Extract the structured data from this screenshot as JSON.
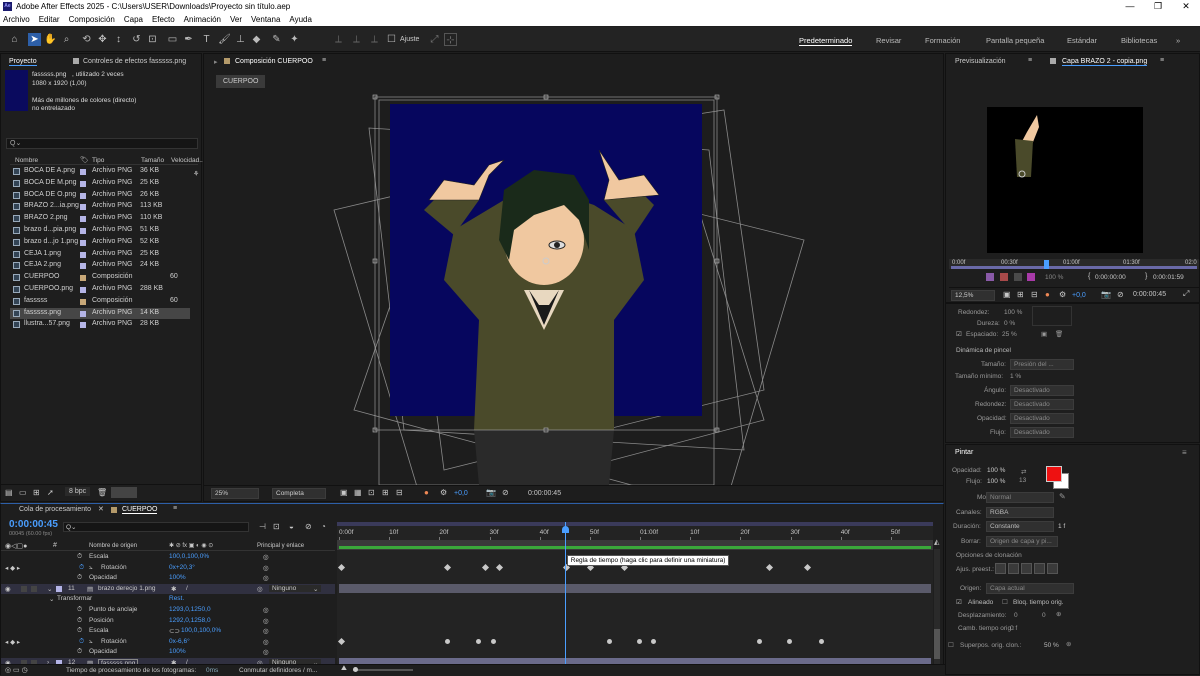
{
  "window": {
    "title": "Adobe After Effects 2025 - C:\\Users\\USER\\Downloads\\Proyecto sin título.aep",
    "app_icon": "Ae",
    "minimize": "—",
    "maximize": "❐",
    "close": "✕"
  },
  "menu": [
    "Archivo",
    "Editar",
    "Composición",
    "Capa",
    "Efecto",
    "Animación",
    "Ver",
    "Ventana",
    "Ayuda"
  ],
  "toolbar": {
    "snap_label": "Ajuste",
    "workspaces": [
      "Predeterminado",
      "Revisar",
      "Formación",
      "Pantalla pequeña",
      "Estándar",
      "Bibliotecas"
    ]
  },
  "project": {
    "tab": "Proyecto",
    "effects_tab": "Controles de efectos fasssss.png",
    "item_name": "fasssss.png",
    "item_usage": ", utilizado 2 veces",
    "item_dims": "1080 x 1920 (1,00)",
    "item_colors": "Más de millones de colores (directo)",
    "item_interlace": "no entrelazado",
    "search_placeholder": "Q⌄",
    "headers": {
      "name": "Nombre",
      "type": "Tipo",
      "size": "Tamaño",
      "speed": "Velocidad..."
    },
    "items": [
      {
        "name": "BOCA DE A.png",
        "type": "Archivo PNG",
        "size": "36 KB",
        "extra": ""
      },
      {
        "name": "BOCA DE M.png",
        "type": "Archivo PNG",
        "size": "25 KB",
        "extra": ""
      },
      {
        "name": "BOCA DE O.png",
        "type": "Archivo PNG",
        "size": "26 KB",
        "extra": ""
      },
      {
        "name": "BRAZO 2...ia.png",
        "type": "Archivo PNG",
        "size": "113 KB",
        "extra": ""
      },
      {
        "name": "BRAZO 2.png",
        "type": "Archivo PNG",
        "size": "110 KB",
        "extra": ""
      },
      {
        "name": "brazo d...pia.png",
        "type": "Archivo PNG",
        "size": "51 KB",
        "extra": ""
      },
      {
        "name": "brazo d...jo 1.png",
        "type": "Archivo PNG",
        "size": "52 KB",
        "extra": ""
      },
      {
        "name": "CEJA 1.png",
        "type": "Archivo PNG",
        "size": "25 KB",
        "extra": ""
      },
      {
        "name": "CEJA 2.png",
        "type": "Archivo PNG",
        "size": "24 KB",
        "extra": ""
      },
      {
        "name": "CUERPOO",
        "type": "Composición",
        "size": "",
        "extra": "60"
      },
      {
        "name": "CUERPOO.png",
        "type": "Archivo PNG",
        "size": "288 KB",
        "extra": ""
      },
      {
        "name": "fasssss",
        "type": "Composición",
        "size": "",
        "extra": "60"
      },
      {
        "name": "fasssss.png",
        "type": "Archivo PNG",
        "size": "14 KB",
        "extra": ""
      },
      {
        "name": "llustra...57.png",
        "type": "Archivo PNG",
        "size": "28 KB",
        "extra": ""
      }
    ],
    "bpc": "8 bpc"
  },
  "composition": {
    "tab": "Composición CUERPOO",
    "crumb": "CUERPOO",
    "zoom": "25%",
    "quality": "Completa",
    "exposure": "+0,0",
    "timecode": "0:00:00:45"
  },
  "preview": {
    "tab1": "Previsualización",
    "tab2": "Capa BRAZO 2 - copia.png",
    "ruler": [
      "0:00f",
      "00:30f",
      "01:00f",
      "01:30f",
      "02:0"
    ],
    "opacity": "100 %",
    "tc_start": "0:00:00:00",
    "tc_end": "0:00:01:59",
    "exposure": "+0,0",
    "zoom": "12,5%",
    "tc_current": "0:00:00:45"
  },
  "brush": {
    "roundness_label": "Redondez:",
    "roundness_value": "100 %",
    "hardness_label": "Dureza:",
    "hardness_value": "0 %",
    "spacing_label": "Espaciado:",
    "spacing_value": "25 %",
    "dynamics_title": "Dinámica de pincel",
    "size_label": "Tamaño:",
    "size_value": "Presión del ...",
    "minsize_label": "Tamaño mínimo:",
    "minsize_value": "1 %",
    "angle_label": "Ángulo:",
    "angle_value": "Desactivado",
    "round2_label": "Redondez:",
    "round2_value": "Desactivado",
    "opacity_label": "Opacidad:",
    "opacity_value": "Desactivado",
    "flow_label": "Flujo:",
    "flow_value": "Desactivado"
  },
  "paint": {
    "title": "Pintar",
    "opacity_label": "Opacidad:",
    "opacity_value": "100 %",
    "flow_label": "Flujo:",
    "flow_value": "100 %",
    "small_num": "13",
    "fg_color": "#ee1111",
    "mode_label": "Modo:",
    "mode_value": "Normal",
    "channels_label": "Canales:",
    "channels_value": "RGBA",
    "duration_label": "Duración:",
    "duration_value": "Constante",
    "duration_num": "1 f",
    "erase_label": "Borrar:",
    "erase_value": "Origen de capa y pi...",
    "clone_title": "Opciones de clonación",
    "preset_label": "Ajus. preest.:",
    "origin_label": "Origen:",
    "origin_value": "Capa actual",
    "aligned_label": "Alineado",
    "lock_label": "Bloq. tiempo orig.",
    "offset_label": "Desplazamiento:",
    "offset_x": "0",
    "offset_y": "0",
    "time_label": "Camb. tiempo orig.:",
    "time_value": "0 f",
    "overlay_label": "Superpos. orig. clon.:",
    "overlay_value": "50 %"
  },
  "timeline": {
    "tab_queue": "Cola de procesamiento",
    "tab_comp": "CUERPOO",
    "timecode": "0:00:00:45",
    "fps": "00045 (60.00 fps)",
    "search_placeholder": "Q⌄",
    "col_source": "Nombre de origen",
    "col_parent": "Principal y enlace",
    "ruler": [
      "0:00f",
      "10f",
      "20f",
      "30f",
      "40f",
      "50f",
      "01:00f",
      "10f",
      "20f",
      "30f",
      "40f",
      "50f"
    ],
    "tooltip": "Regla de tiempo (haga clic para definir una miniatura)",
    "rows": {
      "r0_name": "Escala",
      "r0_val": "100,0,100,0%",
      "r1_name": "Rotación",
      "r1_val": "0x+20,3°",
      "r2_name": "Opacidad",
      "r2_val": "100%",
      "layer11_num": "11",
      "layer11_name": "brazo derecjo 1.png",
      "layer11_parent": "Ninguno",
      "transform": "Transformar",
      "reset": "Rest.",
      "anchor_name": "Punto de anclaje",
      "anchor_val": "1293,0,1250,0",
      "pos_name": "Posición",
      "pos_val": "1292,0,1258,0",
      "scale_name": "Escala",
      "scale_val": "100,0,100,0%",
      "rot_name": "Rotación",
      "rot_val": "0x-6,6°",
      "op_name": "Opacidad",
      "op_val": "100%",
      "layer12_num": "12",
      "layer12_name": "fasssss.png",
      "layer12_parent": "Ninguno"
    },
    "status_render": "Tiempo de procesamiento de los fotogramas:",
    "status_render_val": "0ms",
    "status_toggle": "Conmutar definidores / m...",
    "playhead_frames": 45,
    "total_frames": 118
  }
}
